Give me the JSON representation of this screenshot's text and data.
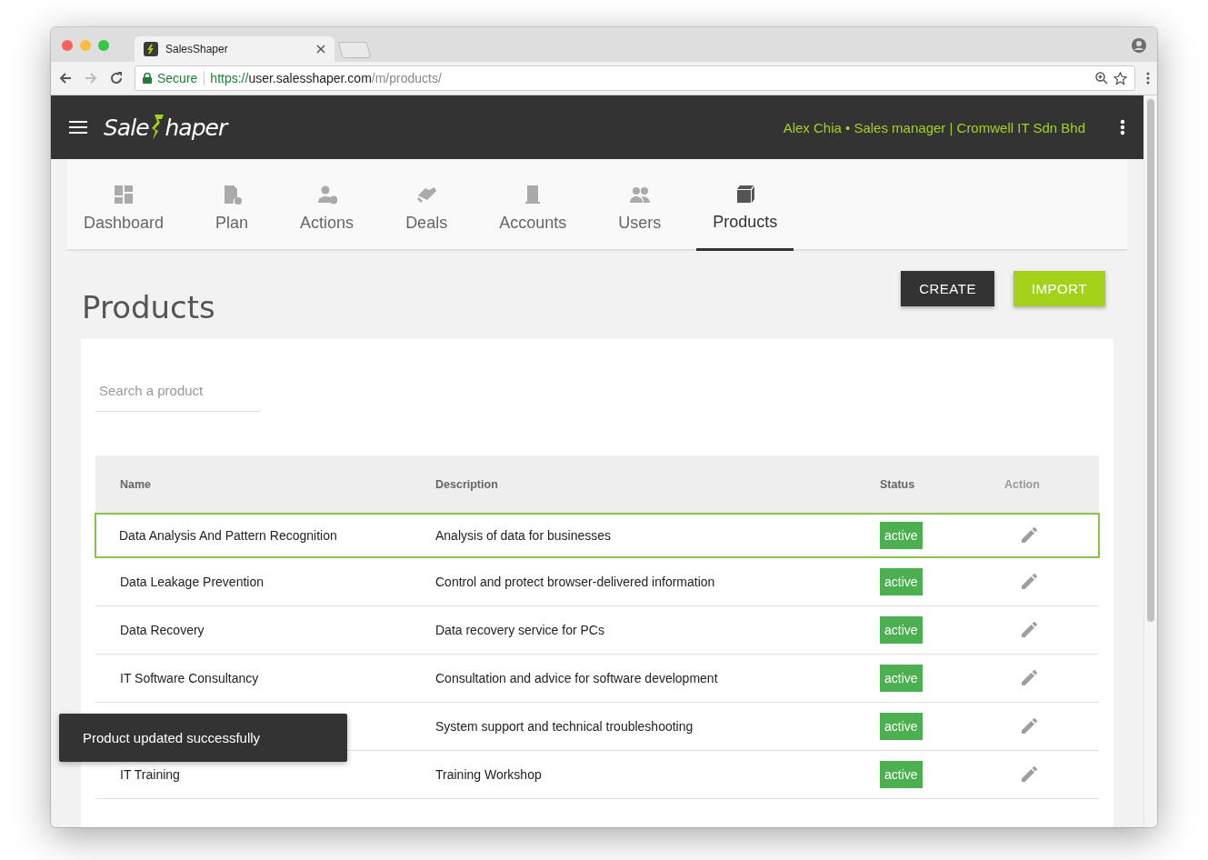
{
  "browser": {
    "tab_title": "SalesShaper",
    "secure_label": "Secure",
    "url_scheme": "https://",
    "url_host": "user.salesshaper.com",
    "url_path": "/m/products/"
  },
  "header": {
    "logo_start": "Sale",
    "logo_end": "haper",
    "user_info": "Alex Chia • Sales manager | Cromwell IT Sdn Bhd"
  },
  "nav": [
    {
      "label": "Dashboard",
      "selected": false
    },
    {
      "label": "Plan",
      "selected": false
    },
    {
      "label": "Actions",
      "selected": false
    },
    {
      "label": "Deals",
      "selected": false
    },
    {
      "label": "Accounts",
      "selected": false
    },
    {
      "label": "Users",
      "selected": false
    },
    {
      "label": "Products",
      "selected": true
    }
  ],
  "page_title": "Products",
  "buttons": [
    {
      "label": "CREATE",
      "kind": "dark"
    },
    {
      "label": "IMPORT",
      "kind": "accent"
    }
  ],
  "search": {
    "placeholder": "Search a product"
  },
  "table": {
    "columns": [
      "Name",
      "Description",
      "Status",
      "Action"
    ],
    "rows": [
      {
        "name": "Data Analysis And Pattern Recognition",
        "description": "Analysis of data for businesses",
        "status": "active",
        "selected": true
      },
      {
        "name": "Data Leakage Prevention",
        "description": "Control and protect browser-delivered information",
        "status": "active",
        "selected": false
      },
      {
        "name": "Data Recovery",
        "description": "Data recovery service for PCs",
        "status": "active",
        "selected": false
      },
      {
        "name": "IT Software Consultancy",
        "description": "Consultation and advice for software development",
        "status": "active",
        "selected": false
      },
      {
        "description": "System support and technical troubleshooting",
        "status": "active",
        "selected": false
      },
      {
        "name": "IT Training",
        "description": "Training Workshop",
        "status": "active",
        "selected": false
      }
    ]
  },
  "toast": "Product updated successfully"
}
